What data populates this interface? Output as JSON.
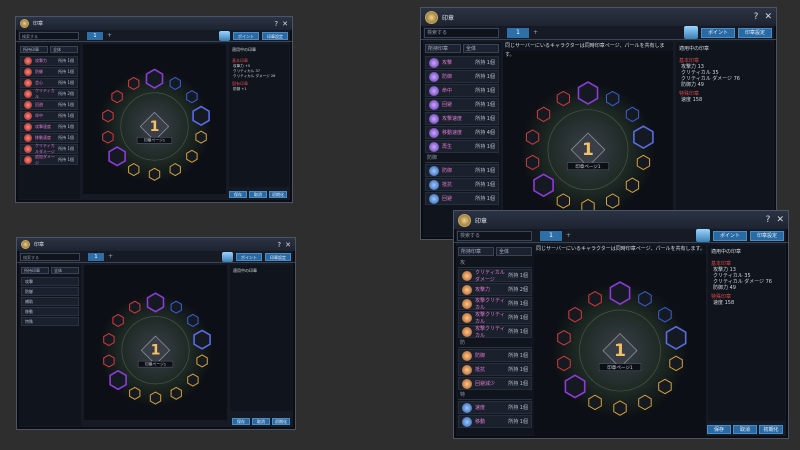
{
  "w1": {
    "title": "印章",
    "search_placeholder": "検索する",
    "tab": "1",
    "tab_add": "+",
    "points_label": "ポイント",
    "seal_set_label": "印章設定",
    "filter_a": "所持印章",
    "filter_b": "全体",
    "items": [
      {
        "name": "攻撃力",
        "count": "所持 1個"
      },
      {
        "name": "防御",
        "count": "所持 1個"
      },
      {
        "name": "会心",
        "count": "所持 1個"
      },
      {
        "name": "クリティカル",
        "count": "所持 2個"
      },
      {
        "name": "回避",
        "count": "所持 1個"
      },
      {
        "name": "命中",
        "count": "所持 1個"
      },
      {
        "name": "攻撃速度",
        "count": "所持 1個"
      },
      {
        "name": "移動速度",
        "count": "所持 1個"
      },
      {
        "name": "クリティカルダメージ",
        "count": "所持 1個"
      },
      {
        "name": "追加ダメージ",
        "count": "所持 1個"
      }
    ],
    "page_number": "1",
    "page_label": "印章ページ1",
    "panel_title": "適用中の印章",
    "panel_sect_1": "基本印章",
    "panel_sect_2": "固有印章",
    "stats": [
      "攻撃力 +5",
      "クリティカル 37",
      "クリティカル ダメージ 26",
      "防御 +1"
    ],
    "buttons": [
      "保存",
      "取消",
      "初期化"
    ]
  },
  "w2": {
    "title": "印章",
    "search_placeholder": "検索する",
    "tab": "1",
    "tab_add": "+",
    "points_label": "ポイント",
    "seal_set_label": "印章設定",
    "filter_a": "所持印章",
    "filter_b": "全体",
    "categories": [
      "攻撃",
      "防御",
      "補助",
      "移動",
      "特殊"
    ],
    "page_number": "1",
    "page_label": "印章ページ1",
    "panel_title": "適用中の印章",
    "buttons": [
      "保存",
      "取消",
      "初期化"
    ]
  },
  "w3": {
    "title": "印章",
    "search_placeholder": "検索する",
    "tab": "1",
    "tab_add": "+",
    "points_label": "ポイント",
    "seal_set_label": "印章設定",
    "filter_a": "所持印章",
    "filter_b": "全体",
    "banner": "同じサーバーにいるキャラクターは同時印章ページ、パールを共有します。",
    "items": [
      {
        "name": "攻撃",
        "count": "所持 1個"
      },
      {
        "name": "防御",
        "count": "所持 1個"
      },
      {
        "name": "命中",
        "count": "所持 1個"
      },
      {
        "name": "回避",
        "count": "所持 1個"
      },
      {
        "name": "攻撃速度",
        "count": "所持 1個"
      },
      {
        "name": "移動速度",
        "count": "所持 4個"
      },
      {
        "name": "再生",
        "count": "所持 1個"
      }
    ],
    "section": "防御",
    "items2": [
      {
        "name": "防御",
        "count": "所持 1個"
      },
      {
        "name": "抵抗",
        "count": "所持 1個"
      },
      {
        "name": "回避",
        "count": "所持 1個"
      }
    ],
    "page_number": "1",
    "page_label": "印章ページ1",
    "panel_title": "適用中の印章",
    "panel_sect_1": "基本印章",
    "panel_sect_2": "特殊印章",
    "stats": [
      "攻撃力 13",
      "クリティカル 35",
      "クリティカル ダメージ 76",
      "防御力 49"
    ],
    "stats2": [
      "速度 158"
    ]
  },
  "w4": {
    "title": "印章",
    "search_placeholder": "検索する",
    "tab": "1",
    "tab_add": "+",
    "points_label": "ポイント",
    "seal_set_label": "印章設定",
    "filter_a": "所持印章",
    "filter_b": "全体",
    "banner": "同じサーバーにいるキャラクターは同時印章ページ、パールを共有します。",
    "section_a": "攻",
    "items": [
      {
        "name": "クリティカルダメージ",
        "count": "所持 1個"
      },
      {
        "name": "攻撃力",
        "count": "所持 2個"
      },
      {
        "name": "攻撃クリティカル",
        "count": "所持 1個"
      },
      {
        "name": "攻撃クリティカル",
        "count": "所持 1個"
      },
      {
        "name": "攻撃クリティカル",
        "count": "所持 1個"
      }
    ],
    "section_b": "防",
    "items2": [
      {
        "name": "防御",
        "count": "所持 1個"
      },
      {
        "name": "抵抗",
        "count": "所持 1個"
      },
      {
        "name": "回避減少",
        "count": "所持 1個"
      }
    ],
    "section_c": "特",
    "items3": [
      {
        "name": "速度",
        "count": "所持 1個"
      },
      {
        "name": "移動",
        "count": "所持 1個"
      }
    ],
    "page_number": "1",
    "page_label": "印章ページ1",
    "panel_title": "適用中の印章",
    "panel_sect_1": "基本印章",
    "panel_sect_2": "特殊印章",
    "stats": [
      "攻撃力 13",
      "クリティカル 35",
      "クリティカル ダメージ 76",
      "防御力 49"
    ],
    "stats2": [
      "速度 158"
    ],
    "buttons": [
      "保存",
      "取消",
      "初期化"
    ]
  }
}
